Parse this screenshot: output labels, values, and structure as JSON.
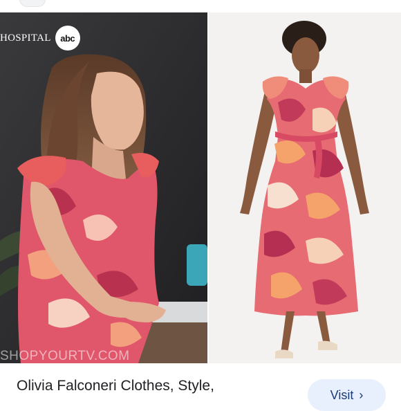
{
  "result_card": {
    "network_text": "Hospital",
    "network_logo": "abc",
    "watermark": "SHOPYOURTV.COM",
    "caption": "Olivia Falconeri Clothes, Style,",
    "visit_label": "Visit",
    "visit_icon": "chevron-right-icon",
    "visit_icon_glyph": "›"
  },
  "colors": {
    "visit_bg": "#e8f0fe",
    "visit_text": "#1a3a75",
    "caption_text": "#202124",
    "dress_primary": "#e0566a",
    "dress_dark": "#b8324f",
    "dress_light": "#f7c2b4"
  }
}
